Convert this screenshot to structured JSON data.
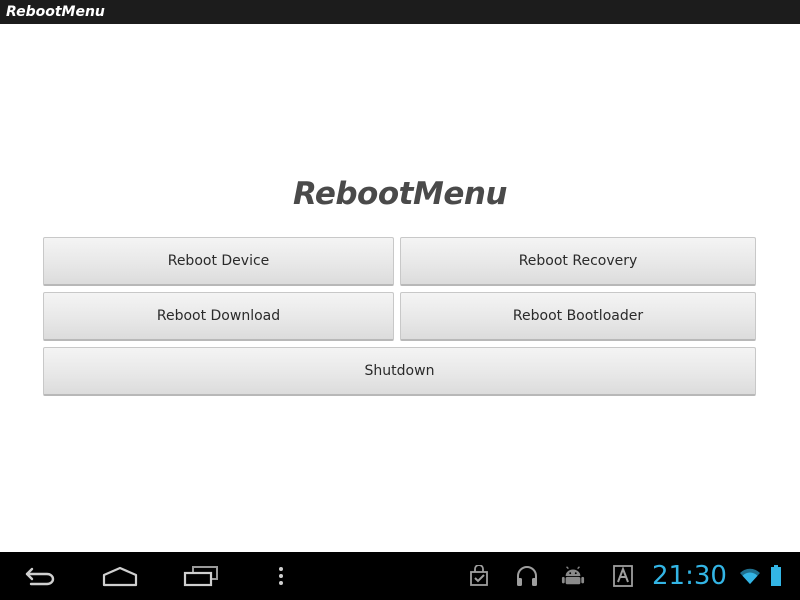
{
  "app": {
    "title": "RebootMenu"
  },
  "main": {
    "heading": "RebootMenu",
    "buttons": {
      "reboot_device": "Reboot Device",
      "reboot_recovery": "Reboot Recovery",
      "reboot_download": "Reboot Download",
      "reboot_bootloader": "Reboot Bootloader",
      "shutdown": "Shutdown"
    }
  },
  "system_bar": {
    "nav_icons": [
      "back-icon",
      "home-icon",
      "recent-apps-icon",
      "menu-icon"
    ],
    "notification_icons": [
      "market-bag-icon",
      "headphones-icon",
      "android-icon",
      "keyboard-a-icon"
    ],
    "clock": "21:30",
    "status_icons": [
      "wifi-icon",
      "battery-icon"
    ],
    "colors": {
      "clock": "#33b5e5",
      "bar_background": "#000000",
      "title_bar_background": "#1c1c1c"
    }
  }
}
